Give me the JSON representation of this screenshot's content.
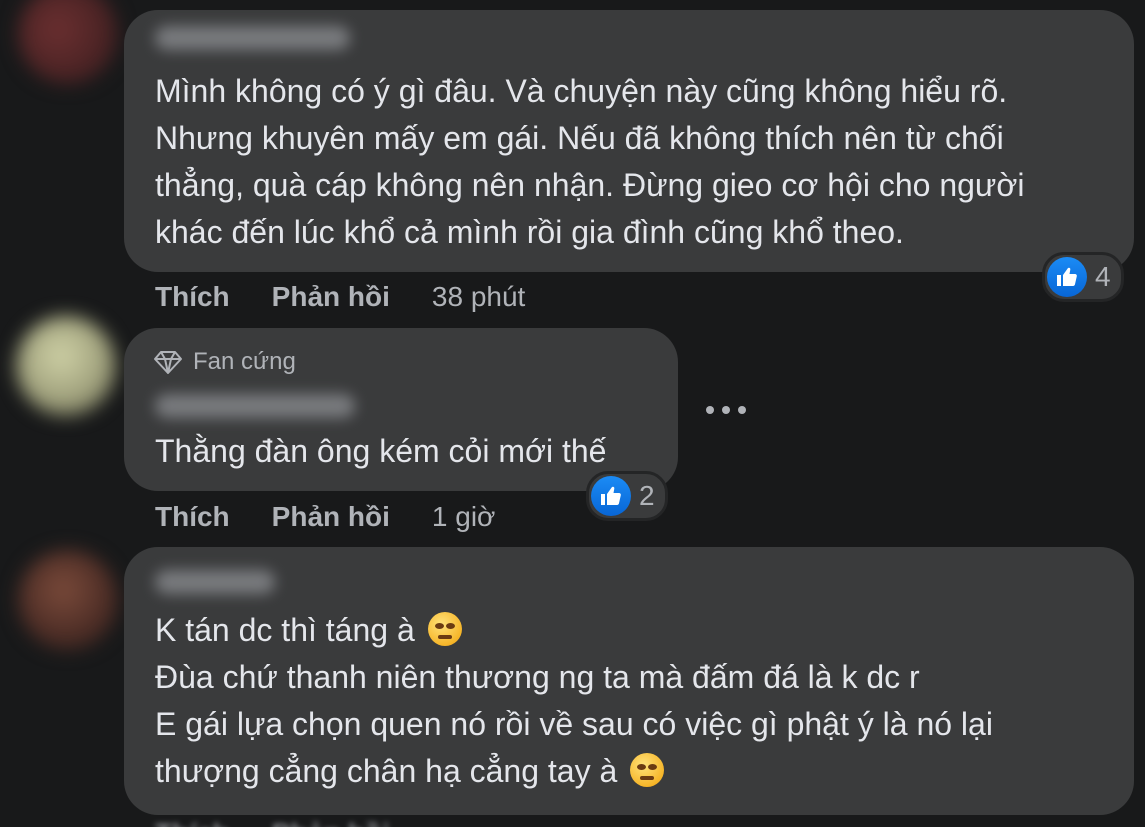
{
  "comments": [
    {
      "badge": "",
      "lines": [
        "Mình không có ý gì đâu. Và chuyện này cũng không hiểu rõ.",
        "Nhưng khuyên mấy em gái. Nếu đã không thích nên từ chối",
        "thẳng, quà cáp không nên nhận. Đừng gieo cơ hội cho người",
        "khác đến lúc khổ cả mình rồi gia đình cũng khổ theo."
      ],
      "reaction_count": "4",
      "like_label": "Thích",
      "reply_label": "Phản hồi",
      "time": "38 phút"
    },
    {
      "badge": "Fan cứng",
      "lines": [
        "Thằng đàn ông kém cỏi mới thế"
      ],
      "reaction_count": "2",
      "like_label": "Thích",
      "reply_label": "Phản hồi",
      "time": "1 giờ"
    },
    {
      "badge": "",
      "lines": [
        "K tán dc thì táng à",
        "Đùa chứ thanh niên thương ng ta mà đấm đá là k dc r",
        "E gái lựa chọn quen nó rồi về sau có việc gì phật ý là nó lại",
        "thượng cẳng chân hạ cẳng tay à"
      ],
      "like_label": "Thích",
      "reply_label": "Phản hồi",
      "time": ""
    }
  ],
  "icons": {
    "like": "thumbs-up-icon",
    "badge": "diamond-icon",
    "more": "more-options-icon",
    "emoji_1": "flushed-face-emoji",
    "emoji_2": "weary-face-emoji"
  },
  "colors": {
    "background": "#18191a",
    "bubble": "#3a3b3c",
    "text": "#e4e6eb",
    "secondary_text": "#b0b3b8",
    "like_blue": "#1b8bf5"
  }
}
